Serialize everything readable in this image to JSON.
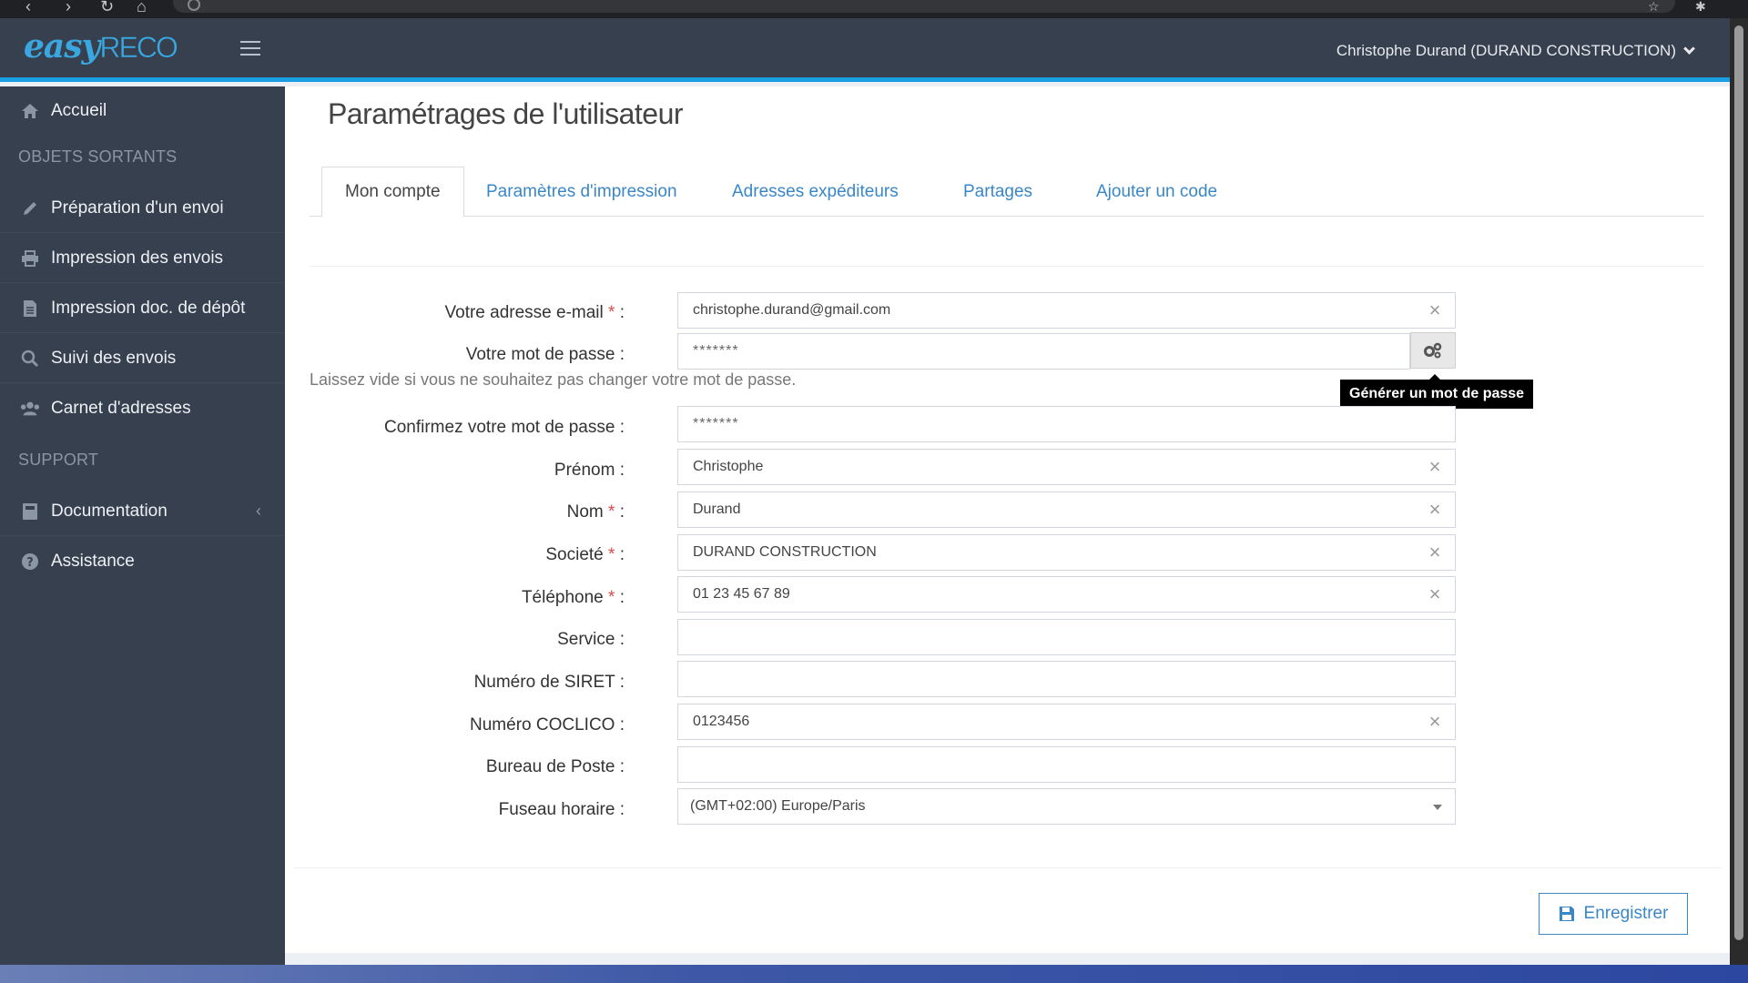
{
  "header": {
    "logo_easy": "easy",
    "logo_reco": "RECO",
    "user": "Christophe Durand (DURAND CONSTRUCTION)"
  },
  "sidebar": {
    "home": "Accueil",
    "section_outgoing": "OBJETS SORTANTS",
    "items": [
      {
        "label": "Préparation d'un envoi",
        "icon": "pencil-icon"
      },
      {
        "label": "Impression des envois",
        "icon": "printer-icon"
      },
      {
        "label": "Impression doc. de dépôt",
        "icon": "document-icon"
      },
      {
        "label": "Suivi des envois",
        "icon": "search-icon"
      },
      {
        "label": "Carnet d'adresses",
        "icon": "users-icon"
      }
    ],
    "section_support": "SUPPORT",
    "support_items": [
      {
        "label": "Documentation",
        "icon": "book-icon"
      },
      {
        "label": "Assistance",
        "icon": "help-icon"
      }
    ]
  },
  "page": {
    "title": "Paramétrages de l'utilisateur",
    "tabs": [
      "Mon compte",
      "Paramètres d'impression",
      "Adresses expéditeurs",
      "Partages",
      "Ajouter un code"
    ],
    "active_tab": "Mon compte"
  },
  "form": {
    "email": {
      "label": "Votre adresse e-mail",
      "value": "christophe.durand@gmail.com",
      "required": true
    },
    "password": {
      "label": "Votre mot de passe :",
      "value": "*******",
      "help": "Laissez vide si vous ne souhaitez pas changer votre mot de passe.",
      "tooltip": "Générer un mot de passe"
    },
    "password_confirm": {
      "label": "Confirmez votre mot de passe :",
      "value": "*******"
    },
    "firstname": {
      "label": "Prénom :",
      "value": "Christophe"
    },
    "lastname": {
      "label": "Nom",
      "value": "Durand",
      "required": true
    },
    "company": {
      "label": "Societé",
      "value": "DURAND CONSTRUCTION",
      "required": true
    },
    "phone": {
      "label": "Téléphone",
      "value": "01 23 45 67 89",
      "required": true
    },
    "service": {
      "label": "Service :",
      "value": ""
    },
    "siret": {
      "label": "Numéro de SIRET :",
      "value": ""
    },
    "coclico": {
      "label": "Numéro COCLICO :",
      "value": "0123456"
    },
    "post_office": {
      "label": "Bureau de Poste :",
      "value": ""
    },
    "timezone": {
      "label": "Fuseau horaire :",
      "value": "(GMT+02:00) Europe/Paris"
    },
    "required_mark": "*",
    "colon": ":"
  },
  "actions": {
    "save": "Enregistrer"
  },
  "colors": {
    "sidebar_bg": "#36404f",
    "accent": "#1a9ee2",
    "link": "#3a87c8",
    "required": "#e04848"
  }
}
